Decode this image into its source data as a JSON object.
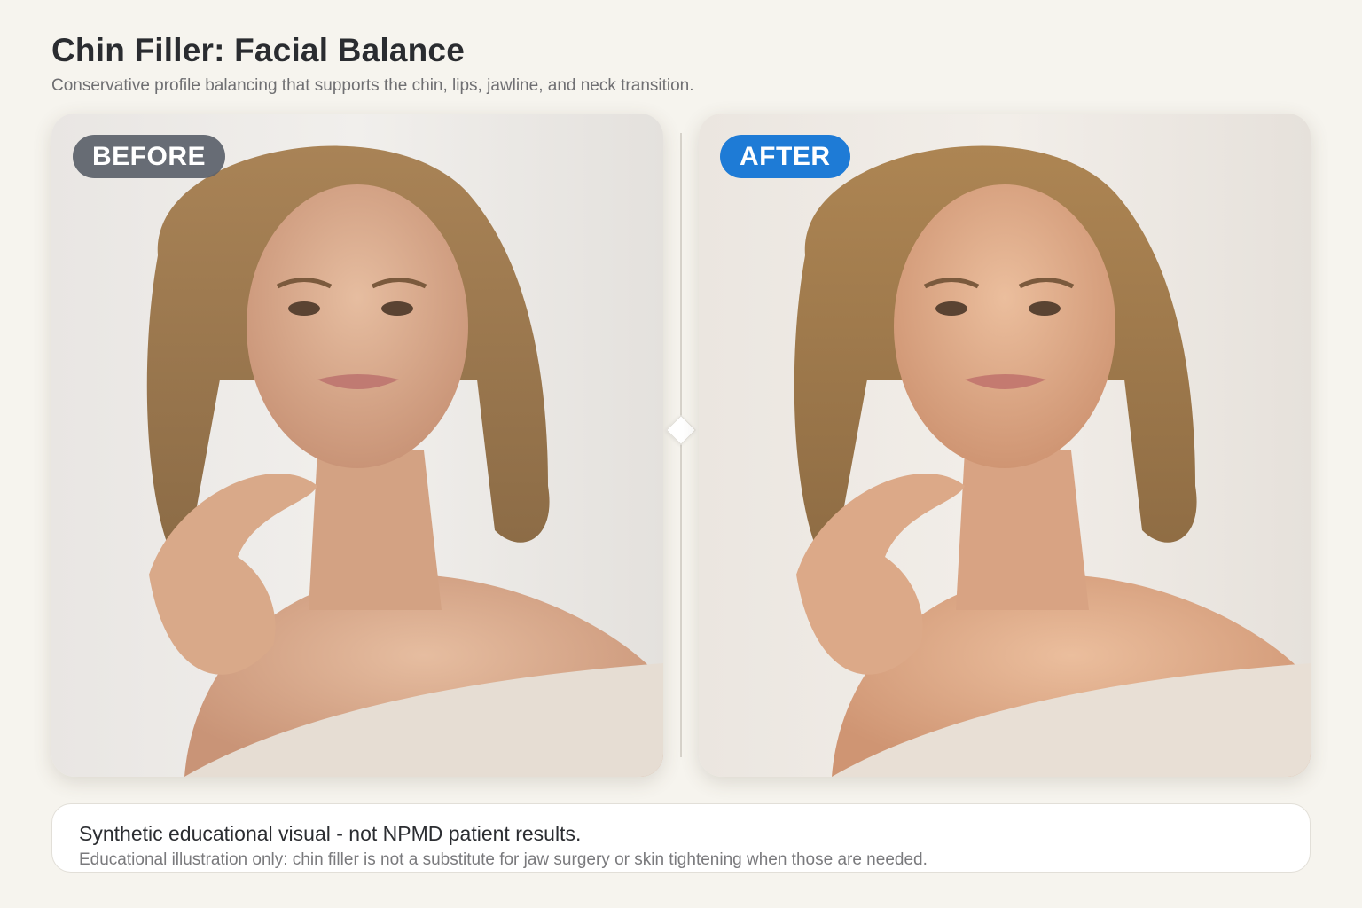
{
  "header": {
    "title": "Chin Filler: Facial Balance",
    "subtitle": "Conservative profile balancing that supports the chin, lips, jawline, and neck transition."
  },
  "panels": {
    "before": {
      "label": "BEFORE",
      "badge_color": "#5c626c",
      "image": "portrait-before"
    },
    "after": {
      "label": "AFTER",
      "badge_color": "#1e7bd6",
      "image": "portrait-after"
    }
  },
  "divider": {
    "icon": "diamond-handle-icon"
  },
  "footer": {
    "disclaimer": "Synthetic educational visual - not NPMD patient results.",
    "note": "Educational illustration only: chin filler is not a substitute for jaw surgery or skin tightening when those are needed."
  },
  "colors": {
    "background": "#f6f4ee",
    "accent": "#1e7bd6"
  }
}
